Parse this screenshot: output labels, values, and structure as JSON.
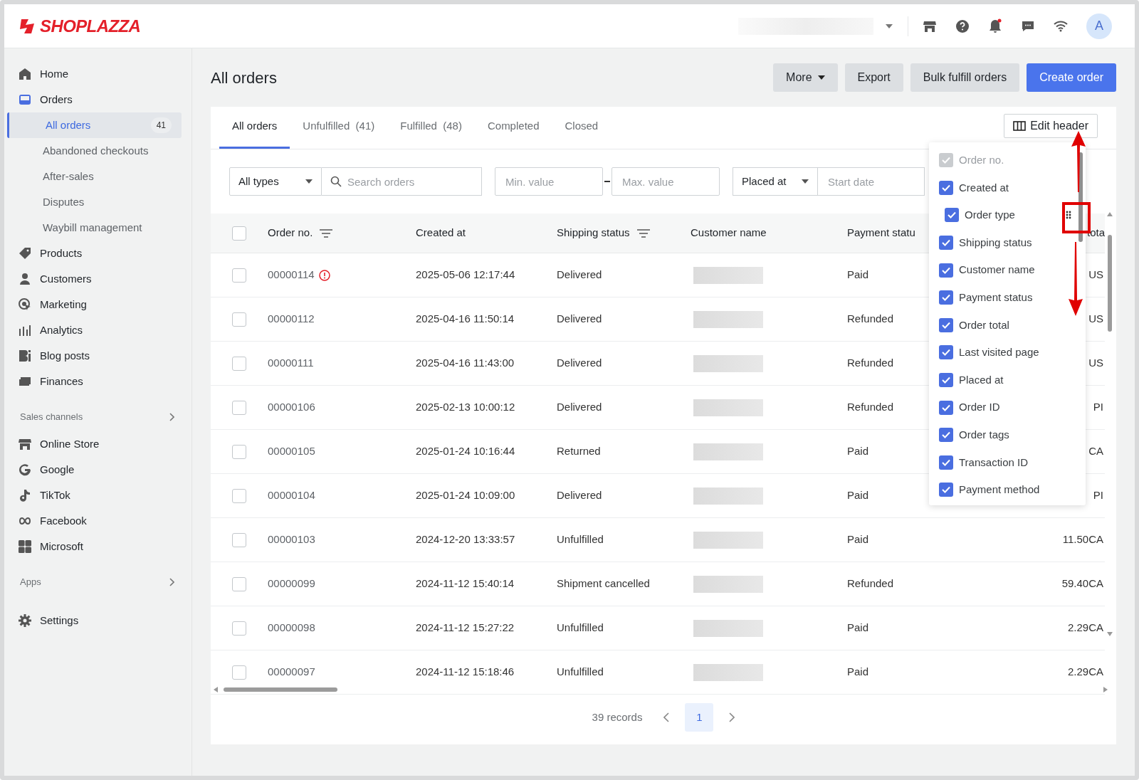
{
  "brand": {
    "name": "SHOPLAZZA"
  },
  "topbar": {
    "avatar": "A",
    "has_notification": true
  },
  "sidebar": {
    "items": [
      {
        "kind": "nav",
        "label": "Home",
        "selected": false
      },
      {
        "kind": "nav",
        "label": "Orders",
        "selected": true,
        "children": [
          {
            "label": "All orders",
            "selected": true,
            "badge": "41"
          },
          {
            "label": "Abandoned checkouts",
            "selected": false
          },
          {
            "label": "After-sales",
            "selected": false
          },
          {
            "label": "Disputes",
            "selected": false
          },
          {
            "label": "Waybill management",
            "selected": false
          }
        ]
      },
      {
        "kind": "nav",
        "label": "Products",
        "selected": false
      },
      {
        "kind": "nav",
        "label": "Customers",
        "selected": false
      },
      {
        "kind": "nav",
        "label": "Marketing",
        "selected": false
      },
      {
        "kind": "nav",
        "label": "Analytics",
        "selected": false
      },
      {
        "kind": "nav",
        "label": "Blog posts",
        "selected": false
      },
      {
        "kind": "nav",
        "label": "Finances",
        "selected": false
      },
      {
        "kind": "section",
        "label": "Sales channels"
      },
      {
        "kind": "nav",
        "label": "Online Store",
        "selected": false
      },
      {
        "kind": "nav",
        "label": "Google",
        "selected": false
      },
      {
        "kind": "nav",
        "label": "TikTok",
        "selected": false
      },
      {
        "kind": "nav",
        "label": "Facebook",
        "selected": false
      },
      {
        "kind": "nav",
        "label": "Microsoft",
        "selected": false
      },
      {
        "kind": "section",
        "label": "Apps"
      },
      {
        "kind": "nav",
        "label": "Settings",
        "selected": false
      }
    ]
  },
  "page": {
    "title": "All orders",
    "actions": [
      {
        "label": "More",
        "kind": "dropdown"
      },
      {
        "label": "Export",
        "kind": "secondary"
      },
      {
        "label": "Bulk fulfill orders",
        "kind": "secondary"
      },
      {
        "label": "Create order",
        "kind": "primary"
      }
    ]
  },
  "tabs": [
    {
      "label": "All orders",
      "selected": true
    },
    {
      "label": "Unfulfilled",
      "count": "(41)",
      "selected": false
    },
    {
      "label": "Fulfilled",
      "count": "(48)",
      "selected": false
    },
    {
      "label": "Completed",
      "selected": false
    },
    {
      "label": "Closed",
      "selected": false
    }
  ],
  "edit_header": {
    "label": "Edit header"
  },
  "filters": {
    "type": "All types",
    "search": {
      "placeholder": "Search orders"
    },
    "min": {
      "placeholder": "Min. value"
    },
    "max": {
      "placeholder": "Max. value"
    },
    "date_field": "Placed at",
    "start_date": {
      "placeholder": "Start date"
    }
  },
  "table": {
    "all_selected": false,
    "columns": [
      {
        "label": "Order no.",
        "filter": true
      },
      {
        "label": "Created at",
        "filter": false
      },
      {
        "label": "Shipping status",
        "filter": true
      },
      {
        "label": "Customer name",
        "filter": false
      },
      {
        "label": "Payment statu",
        "filter": false
      },
      {
        "label": "tota",
        "filter": false
      }
    ],
    "rows": [
      {
        "selected": false,
        "order_no": "00000114",
        "warning": true,
        "created_at": "2025-05-06 12:17:44",
        "shipping": "Delivered",
        "payment": "Paid",
        "total": "US"
      },
      {
        "selected": false,
        "order_no": "00000112",
        "warning": false,
        "created_at": "2025-04-16 11:50:14",
        "shipping": "Delivered",
        "payment": "Refunded",
        "total": "US"
      },
      {
        "selected": false,
        "order_no": "00000111",
        "warning": false,
        "created_at": "2025-04-16 11:43:00",
        "shipping": "Delivered",
        "payment": "Refunded",
        "total": "US"
      },
      {
        "selected": false,
        "order_no": "00000106",
        "warning": false,
        "created_at": "2025-02-13 10:00:12",
        "shipping": "Delivered",
        "payment": "Refunded",
        "total": "PI"
      },
      {
        "selected": false,
        "order_no": "00000105",
        "warning": false,
        "created_at": "2025-01-24 10:16:44",
        "shipping": "Returned",
        "payment": "Paid",
        "total": "CA"
      },
      {
        "selected": false,
        "order_no": "00000104",
        "warning": false,
        "created_at": "2025-01-24 10:09:00",
        "shipping": "Delivered",
        "payment": "Paid",
        "total": "PI"
      },
      {
        "selected": false,
        "order_no": "00000103",
        "warning": false,
        "created_at": "2024-12-20 13:33:57",
        "shipping": "Unfulfilled",
        "payment": "Paid",
        "total": "11.50CA"
      },
      {
        "selected": false,
        "order_no": "00000099",
        "warning": false,
        "created_at": "2024-11-12 15:40:14",
        "shipping": "Shipment cancelled",
        "payment": "Refunded",
        "total": "59.40CA"
      },
      {
        "selected": false,
        "order_no": "00000098",
        "warning": false,
        "created_at": "2024-11-12 15:27:22",
        "shipping": "Unfulfilled",
        "payment": "Paid",
        "total": "2.29CA"
      },
      {
        "selected": false,
        "order_no": "00000097",
        "warning": false,
        "created_at": "2024-11-12 15:18:46",
        "shipping": "Unfulfilled",
        "payment": "Paid",
        "total": "2.29CA"
      }
    ]
  },
  "column_menu": {
    "items": [
      {
        "label": "Order no.",
        "checked": true,
        "disabled": true,
        "dragging": false
      },
      {
        "label": "Created at",
        "checked": true,
        "disabled": false,
        "dragging": false
      },
      {
        "label": "Order type",
        "checked": true,
        "disabled": false,
        "dragging": true
      },
      {
        "label": "Shipping status",
        "checked": true,
        "disabled": false,
        "dragging": false
      },
      {
        "label": "Customer name",
        "checked": true,
        "disabled": false,
        "dragging": false
      },
      {
        "label": "Payment status",
        "checked": true,
        "disabled": false,
        "dragging": false
      },
      {
        "label": "Order total",
        "checked": true,
        "disabled": false,
        "dragging": false
      },
      {
        "label": "Last visited page",
        "checked": true,
        "disabled": false,
        "dragging": false
      },
      {
        "label": "Placed at",
        "checked": true,
        "disabled": false,
        "dragging": false
      },
      {
        "label": "Order ID",
        "checked": true,
        "disabled": false,
        "dragging": false
      },
      {
        "label": "Order tags",
        "checked": true,
        "disabled": false,
        "dragging": false
      },
      {
        "label": "Transaction ID",
        "checked": true,
        "disabled": false,
        "dragging": false
      },
      {
        "label": "Payment method",
        "checked": true,
        "disabled": false,
        "dragging": false
      }
    ]
  },
  "pagination": {
    "records": "39 records",
    "pages": [
      {
        "label": "1",
        "selected": true
      }
    ]
  }
}
